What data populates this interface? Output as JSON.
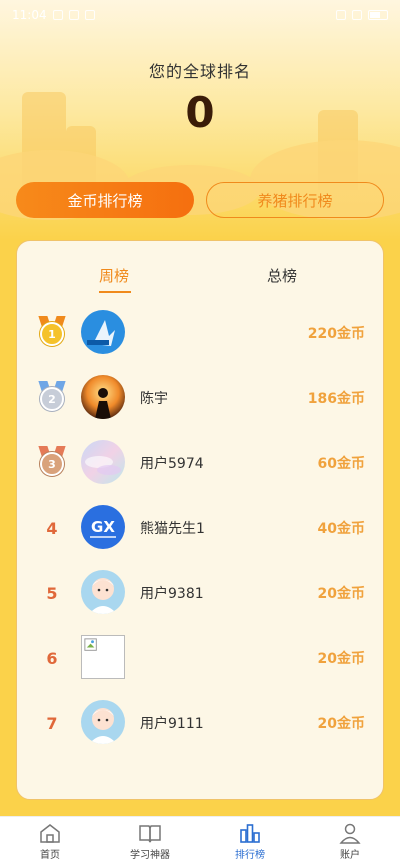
{
  "status_bar": {
    "time": "11:04",
    "battery_level": 0.6
  },
  "header": {
    "rank_title": "您的全球排名",
    "rank_value": "0"
  },
  "switch_tabs": {
    "coin_label": "金币排行榜",
    "pig_label": "养猪排行榜"
  },
  "period_tabs": {
    "week_label": "周榜",
    "total_label": "总榜"
  },
  "leaderboard": [
    {
      "rank": "1",
      "medal": "gold",
      "name": "",
      "coins": "220金币",
      "avatar": "blue-logo"
    },
    {
      "rank": "2",
      "medal": "silver",
      "name": "陈宇",
      "coins": "186金币",
      "avatar": "sunset-silhouette"
    },
    {
      "rank": "3",
      "medal": "bronze",
      "name": "用户5974",
      "coins": "60金币",
      "avatar": "pastel-clouds"
    },
    {
      "rank": "4",
      "name": "熊猫先生1",
      "coins": "40金币",
      "avatar": "gx-logo"
    },
    {
      "rank": "5",
      "name": "用户9381",
      "coins": "20金币",
      "avatar": "cartoon-user"
    },
    {
      "rank": "6",
      "name": "",
      "coins": "20金币",
      "avatar": "broken-image"
    },
    {
      "rank": "7",
      "name": "用户9111",
      "coins": "20金币",
      "avatar": "cartoon-user"
    }
  ],
  "bottom_nav": [
    {
      "label": "首页",
      "icon": "home-icon",
      "active": false
    },
    {
      "label": "学习神器",
      "icon": "book-icon",
      "active": false
    },
    {
      "label": "排行榜",
      "icon": "ranking-icon",
      "active": true
    },
    {
      "label": "账户",
      "icon": "user-icon",
      "active": false
    }
  ],
  "colors": {
    "accent": "#f08a1c",
    "coin_text": "#f0a23d",
    "rank_text": "#e0683a",
    "nav_active": "#2b6ed1",
    "background": "#fbd24a"
  }
}
